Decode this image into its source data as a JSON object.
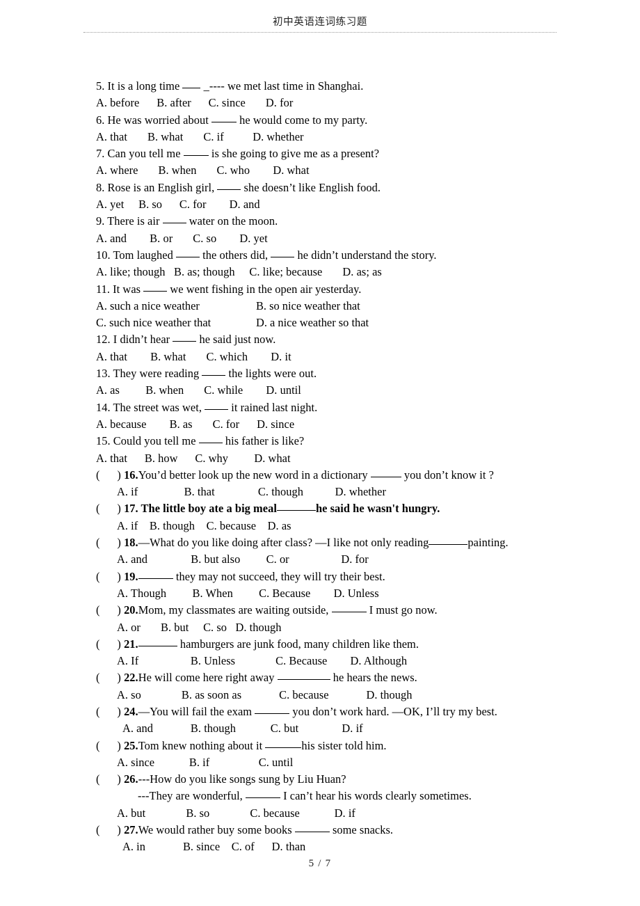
{
  "header": {
    "title": "初中英语连词练习题"
  },
  "footer": {
    "page_label": "5 / 7"
  },
  "questions": [
    {
      "number": "5.",
      "stem_before": "5. It is a long time ",
      "stem_after": " _---- we met last time in Shanghai.",
      "options_line": "A. before      B. after      C. since       D. for"
    },
    {
      "number": "6.",
      "stem_before": "6. He was worried about ",
      "stem_after": " he would come to my party.",
      "options_line": "A. that       B. what       C. if          D. whether"
    },
    {
      "number": "7.",
      "stem_before": "7. Can you tell me ",
      "stem_after": " is she going to give me as a present?",
      "options_line": "A. where       B. when       C. who        D. what"
    },
    {
      "number": "8.",
      "stem_before": "8. Rose is an English girl, ",
      "stem_after": " she doesn’t like English food.",
      "options_line": "A. yet     B. so      C. for        D. and"
    },
    {
      "number": "9.",
      "stem_before": "9. There is air ",
      "stem_after": " water on the moon.",
      "options_line": "A. and        B. or       C. so        D. yet"
    },
    {
      "number": "10.",
      "stem_before": "10. Tom laughed ",
      "stem_mid": " the others did, ",
      "stem_after": " he didn’t understand the story.",
      "options_line": "A. like; though   B. as; though     C. like; because       D. as; as"
    },
    {
      "number": "11.",
      "stem_before": "11. It was ",
      "stem_after": " we went fishing in the open air yesterday.",
      "option_a": "A. such a nice weather",
      "option_b": "B. so nice weather that",
      "option_c": "C. such nice weather that",
      "option_d": "D. a nice weather so that"
    },
    {
      "number": "12.",
      "stem_before": "12. I didn’t hear ",
      "stem_after": " he said just now.",
      "options_line": "A. that        B. what       C. which        D. it"
    },
    {
      "number": "13.",
      "stem_before": "13. They were reading ",
      "stem_after": " the lights were out.",
      "options_line": "A. as         B. when       C. while        D. until"
    },
    {
      "number": "14.",
      "stem_before": "14. The street was wet, ",
      "stem_after": " it rained last night.",
      "options_line": "A. because        B. as       C. for      D. since"
    },
    {
      "number": "15.",
      "stem_before": "15. Could you tell me ",
      "stem_after": " his father is like?",
      "options_line": "A. that      B. how      C. why         D. what"
    },
    {
      "number": "16.",
      "bracket": "(      ) ",
      "stem_before": "You’d better look up the new word in a dictionary ",
      "stem_after": " you don’t know it ?",
      "options_line": "A. if                B. that               C. though           D. whether"
    },
    {
      "number": "17.",
      "bracket": "(      ) ",
      "stem_before": " The little boy ate a big meal",
      "stem_after": "he said he wasn't hungry.",
      "options_line": "A. if    B. though    C. because    D. as"
    },
    {
      "number": "18.",
      "bracket": "(      ) ",
      "stem_before": "—What do you like doing after class? —I like not only reading",
      "stem_after": "painting.",
      "options_line": "A. and               B. but also         C. or                  D. for"
    },
    {
      "number": "19.",
      "bracket": "(      ) ",
      "stem_before": "",
      "stem_after": " they may not succeed, they will try their best.",
      "options_line": "A. Though         B. When         C. Because        D. Unless"
    },
    {
      "number": "20.",
      "bracket": "(      ) ",
      "stem_before": "Mom, my classmates are waiting outside, ",
      "stem_after": " I must go now.",
      "options_line": "A. or       B. but     C. so   D. though"
    },
    {
      "number": "21.",
      "bracket": "(      ) ",
      "stem_before": "",
      "stem_after": " hamburgers are junk food, many children like them.",
      "options_line": "A. If                  B. Unless              C. Because        D. Although"
    },
    {
      "number": "22.",
      "bracket": "(      ) ",
      "stem_before": "He will come here right away ",
      "stem_after": " he hears the news.",
      "options_line": "A. so              B. as soon as             C. because             D. though"
    },
    {
      "number": "24.",
      "bracket": "(      ) ",
      "stem_before": "—You will fail the exam ",
      "stem_after": " you don’t work hard. —OK, I’ll try my best.",
      "options_line": "A. and             B. though            C. but               D. if"
    },
    {
      "number": "25.",
      "bracket": "(      ) ",
      "stem_before": "Tom knew nothing about it ",
      "stem_after": "his sister told him.",
      "options_line": "A. since            B. if                 C. until"
    },
    {
      "number": "26.",
      "bracket": "(      ) ",
      "stem_before": "---How do you like songs sung by Liu Huan?",
      "stem_second_before": "---They are wonderful, ",
      "stem_second_after": " I can’t hear his words clearly sometimes.",
      "options_line": "A. but              B. so              C. because            D. if"
    },
    {
      "number": "27.",
      "bracket": "(      ) ",
      "stem_before": "We would rather buy some books ",
      "stem_after": " some snacks.",
      "options_line": "A. in             B. since    C. of      D. than"
    }
  ]
}
